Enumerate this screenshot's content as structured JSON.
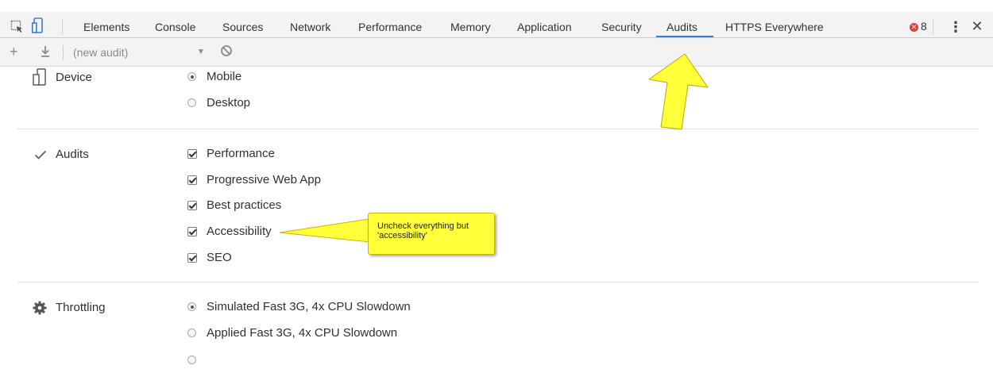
{
  "toolbar": {
    "tabs": [
      "Elements",
      "Console",
      "Sources",
      "Network",
      "Performance",
      "Memory",
      "Application",
      "Security",
      "Audits",
      "HTTPS Everywhere"
    ],
    "active_tab": "Audits",
    "error_count": "8",
    "icons": [
      "inspect-element-icon",
      "device-toolbar-icon",
      "kebab-menu-icon",
      "close-icon",
      "error-icon"
    ]
  },
  "audit_toolbar": {
    "select_value": "(new audit)",
    "icons": [
      "plus-icon",
      "download-icon",
      "dropdown-arrow-icon",
      "clear-icon"
    ]
  },
  "sections": {
    "device": {
      "label": "Device",
      "icon": "device-icon",
      "options": [
        {
          "label": "Mobile",
          "selected": true
        },
        {
          "label": "Desktop",
          "selected": false
        }
      ]
    },
    "audits": {
      "label": "Audits",
      "icon": "checkmark-icon",
      "options": [
        {
          "label": "Performance",
          "checked": true
        },
        {
          "label": "Progressive Web App",
          "checked": true
        },
        {
          "label": "Best practices",
          "checked": true
        },
        {
          "label": "Accessibility",
          "checked": true
        },
        {
          "label": "SEO",
          "checked": true
        }
      ]
    },
    "throttling": {
      "label": "Throttling",
      "icon": "gear-icon",
      "options": [
        {
          "label": "Simulated Fast 3G, 4x CPU Slowdown",
          "selected": true
        },
        {
          "label": "Applied Fast 3G, 4x CPU Slowdown",
          "selected": false
        }
      ]
    }
  },
  "annotation": {
    "callout_text": "Uncheck everything but 'accessibility'",
    "color": "#ffff3a"
  },
  "colors": {
    "active_tab_underline": "#3879d9",
    "error_badge": "#e23b36",
    "toolbar_bg": "#f3f3f3"
  }
}
